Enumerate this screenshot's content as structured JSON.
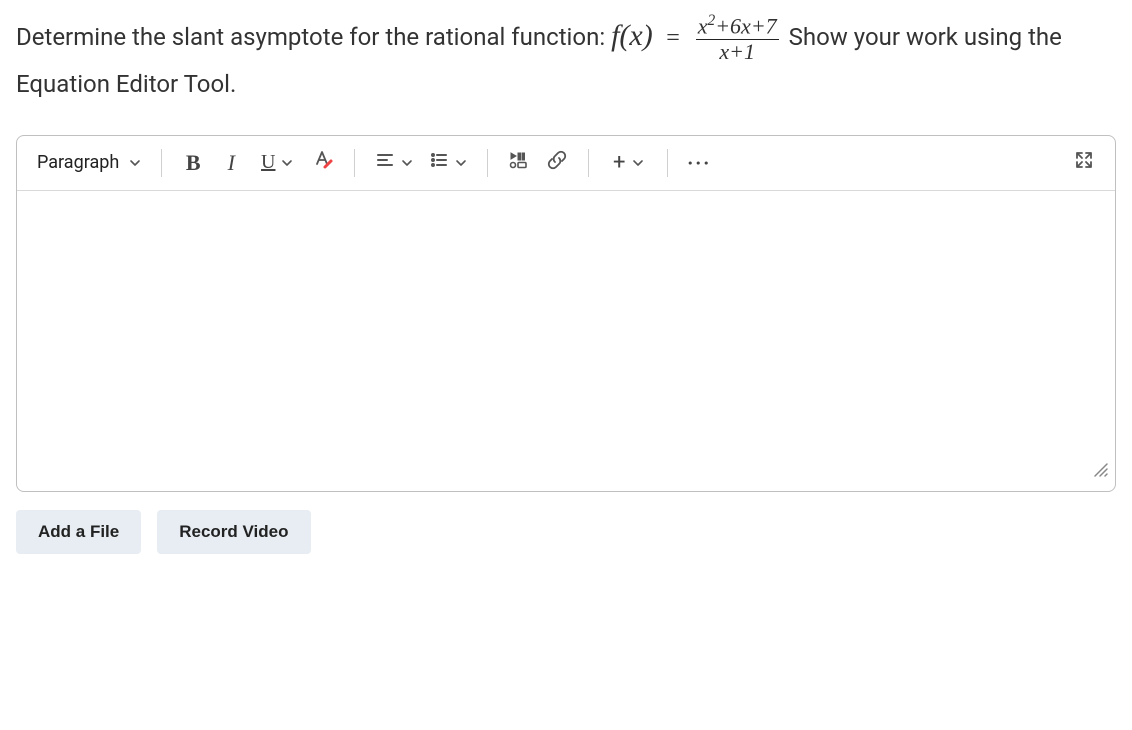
{
  "question": {
    "part1": "Determine the slant asymptote for the rational function:",
    "fn_left": "f(x)",
    "eq": "=",
    "frac_num": "x",
    "frac_num_exp": "2",
    "frac_num_rest": "+6x+7",
    "frac_den": "x+1",
    "part2": "Show your work using the Equation Editor Tool."
  },
  "toolbar": {
    "paragraph": "Paragraph",
    "bold": "B",
    "italic": "I",
    "underline": "U",
    "font_color": "A",
    "plus": "+",
    "more": "···"
  },
  "actions": {
    "add_file": "Add a File",
    "record_video": "Record Video"
  }
}
